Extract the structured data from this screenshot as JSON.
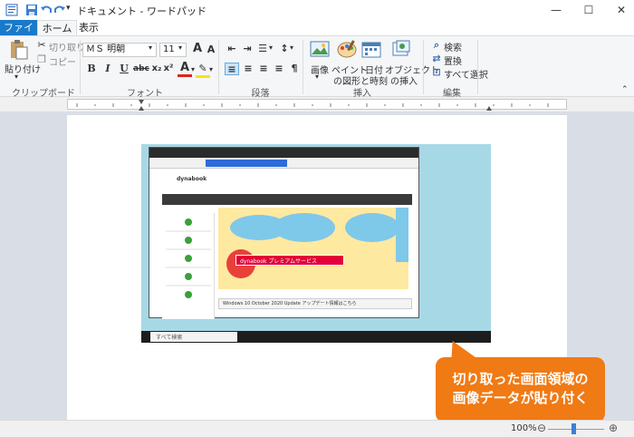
{
  "window": {
    "title": "ドキュメント - ワードパッド",
    "minimize": "—",
    "maximize": "☐",
    "close": "✕"
  },
  "tabs": {
    "file": "ファイル",
    "home": "ホーム",
    "view": "表示"
  },
  "clipboard": {
    "paste": "貼り付け",
    "cut": "切り取り",
    "copy": "コピー",
    "label": "クリップボード"
  },
  "font": {
    "family": "ＭＳ 明朝",
    "size": "11",
    "label": "フォント"
  },
  "paragraph": {
    "label": "段落"
  },
  "insert": {
    "picture": "画像",
    "paint": "ペイント",
    "paint2": "の図形",
    "datetime": "日付",
    "datetime2": "と時刻",
    "object": "オブジェクト",
    "object2": "の挿入",
    "label": "挿入"
  },
  "edit": {
    "find": "検索",
    "replace": "置換",
    "select_all": "すべて選択",
    "label": "編集"
  },
  "callout": {
    "line1": "切り取った画面領域の",
    "line2": "画像データが貼り付く",
    "color": "#f07a14"
  },
  "pasted_image": {
    "site_name": "dynabook",
    "banner_cta": "dynabook プレミアムサービス",
    "footer_link": "Windows 10 October 2020 Update アップデート情報はこちら",
    "taskbar_search": "すべて検索"
  },
  "statusbar": {
    "zoom": "100%"
  },
  "accent": "#1979ca"
}
